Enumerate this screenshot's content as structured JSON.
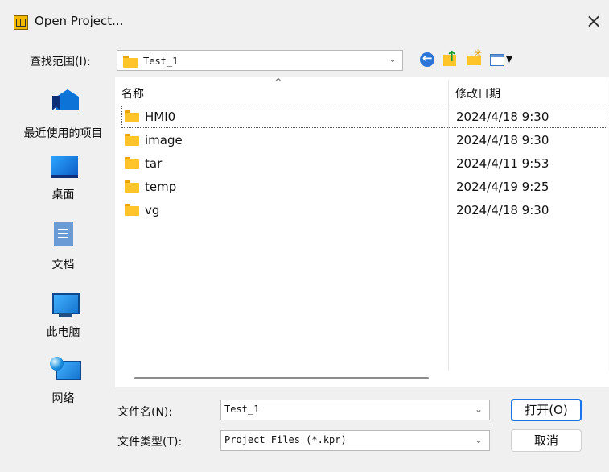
{
  "window": {
    "title": "Open Project...",
    "close_glyph": "×",
    "app_icon": "project-icon",
    "close_icon": "close-icon"
  },
  "toolbar": {
    "look_in_label": "查找范围(I):",
    "look_in_value": "Test_1",
    "back_icon": "back-icon",
    "up_icon": "up-folder-icon",
    "new_folder_icon": "new-folder-icon",
    "view_icon": "view-menu-icon"
  },
  "places": [
    {
      "label": "最近使用的项目",
      "icon": "recent-places-icon"
    },
    {
      "label": "桌面",
      "icon": "desktop-icon"
    },
    {
      "label": "文档",
      "icon": "documents-icon"
    },
    {
      "label": "此电脑",
      "icon": "computer-icon"
    },
    {
      "label": "网络",
      "icon": "network-icon"
    }
  ],
  "file_list": {
    "columns": {
      "name": "名称",
      "date": "修改日期"
    },
    "items": [
      {
        "name": "HMI0",
        "date": "2024/4/18 9:30"
      },
      {
        "name": "image",
        "date": "2024/4/18 9:30"
      },
      {
        "name": "tar",
        "date": "2024/4/11 9:53"
      },
      {
        "name": "temp",
        "date": "2024/4/19 9:25"
      },
      {
        "name": "vg",
        "date": "2024/4/18 9:30"
      }
    ]
  },
  "form": {
    "filename_label": "文件名(N):",
    "filename_value": "Test_1",
    "filetype_label": "文件类型(T):",
    "filetype_value": "Project Files (*.kpr)"
  },
  "buttons": {
    "open": "打开(O)",
    "cancel": "取消"
  }
}
